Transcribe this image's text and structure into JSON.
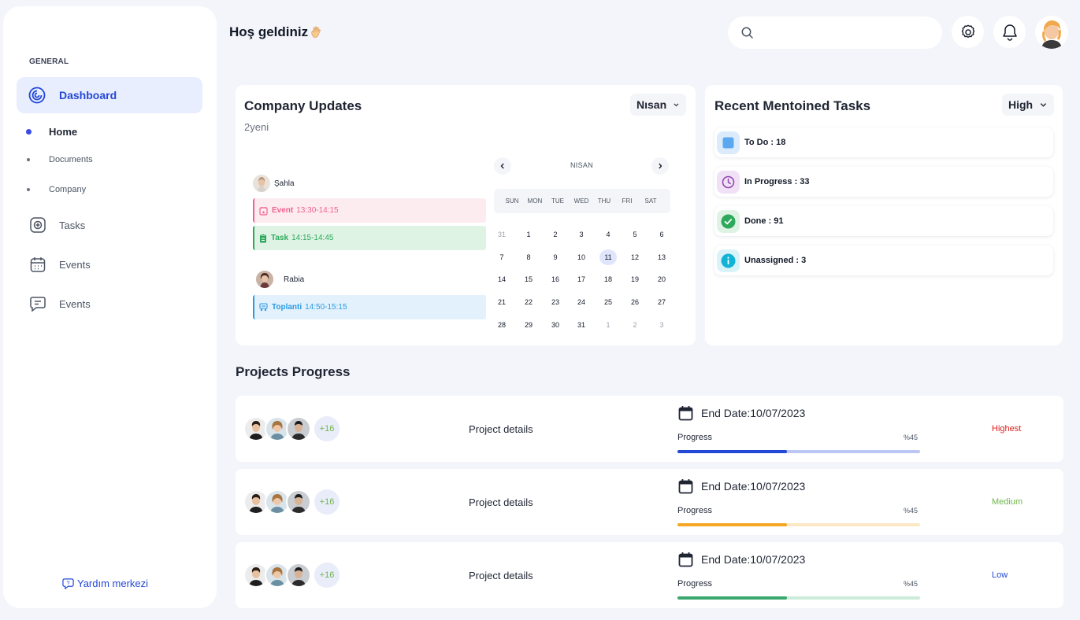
{
  "sidebar": {
    "section_label": "GENERAL",
    "dashboard": "Dashboard",
    "sub_items": [
      "Home",
      "Documents",
      "Company"
    ],
    "tasks": "Tasks",
    "events1": "Events",
    "events2": "Events",
    "help": "Yardım merkezi"
  },
  "header": {
    "greeting": "Hoş geldiniz",
    "search_placeholder": ""
  },
  "company_updates": {
    "title": "Company Updates",
    "month_dropdown": "Nısan",
    "subtitle": "2yeni",
    "people": [
      {
        "name": "Şahla"
      },
      {
        "name": "Rabia"
      }
    ],
    "events": [
      {
        "label": "Event",
        "time": "13:30-14:15",
        "color": "#f06292",
        "bg": "#fdecef"
      },
      {
        "label": "Task",
        "time": "14:15-14:45",
        "color": "#2ea95c",
        "bg": "#dff3e5"
      },
      {
        "label": "Toplanti",
        "time": "14:50-15:15",
        "color": "#2c9be3",
        "bg": "#e2f1fc"
      }
    ],
    "calendar": {
      "month": "NISAN",
      "weekdays": [
        "SUN",
        "MON",
        "TUE",
        "WED",
        "THU",
        "FRI",
        "SAT"
      ],
      "weeks": [
        [
          "31",
          "1",
          "2",
          "3",
          "4",
          "5",
          "6"
        ],
        [
          "7",
          "8",
          "9",
          "10",
          "11",
          "12",
          "13"
        ],
        [
          "14",
          "15",
          "16",
          "17",
          "18",
          "19",
          "20"
        ],
        [
          "21",
          "22",
          "23",
          "24",
          "25",
          "26",
          "27"
        ],
        [
          "28",
          "29",
          "30",
          "31",
          "1",
          "2",
          "3"
        ]
      ],
      "selected": "11"
    }
  },
  "recent_tasks": {
    "title": "Recent Mentoined Tasks",
    "priority_dropdown": "High",
    "items": [
      {
        "label": "To Do : 18",
        "icon": "square-icon",
        "color": "#5aa9f0",
        "bg": "#dcebfb"
      },
      {
        "label": "In Progress : 33",
        "icon": "clock-icon",
        "color": "#8e44ad",
        "bg": "#f0e1f6"
      },
      {
        "label": "Done : 91",
        "icon": "check-circle-icon",
        "color": "#2ea95c",
        "bg": "#dff3e5"
      },
      {
        "label": "Unassigned : 3",
        "icon": "info-icon",
        "color": "#12b3d6",
        "bg": "#d9f3f9"
      }
    ]
  },
  "projects": {
    "title": "Projects Progress",
    "rows": [
      {
        "more": "+16",
        "details": "Project details",
        "end_date": "End Date:10/07/2023",
        "progress_label": "Progress",
        "progress_text": "%45",
        "progress": 0.45,
        "bar": "#2448d6",
        "track": "#bcc6f3",
        "priority": "Highest",
        "priority_color": "#e0201c"
      },
      {
        "more": "+16",
        "details": "Project details",
        "end_date": "End Date:10/07/2023",
        "progress_label": "Progress",
        "progress_text": "%45",
        "progress": 0.45,
        "bar": "#f5a623",
        "track": "#fde8c6",
        "priority": "Medium",
        "priority_color": "#6fb64a"
      },
      {
        "more": "+16",
        "details": "Project details",
        "end_date": "End Date:10/07/2023",
        "progress_label": "Progress",
        "progress_text": "%45",
        "progress": 0.45,
        "bar": "#3aa76d",
        "track": "#cdebdb",
        "priority": "Low",
        "priority_color": "#2448d6"
      }
    ]
  }
}
